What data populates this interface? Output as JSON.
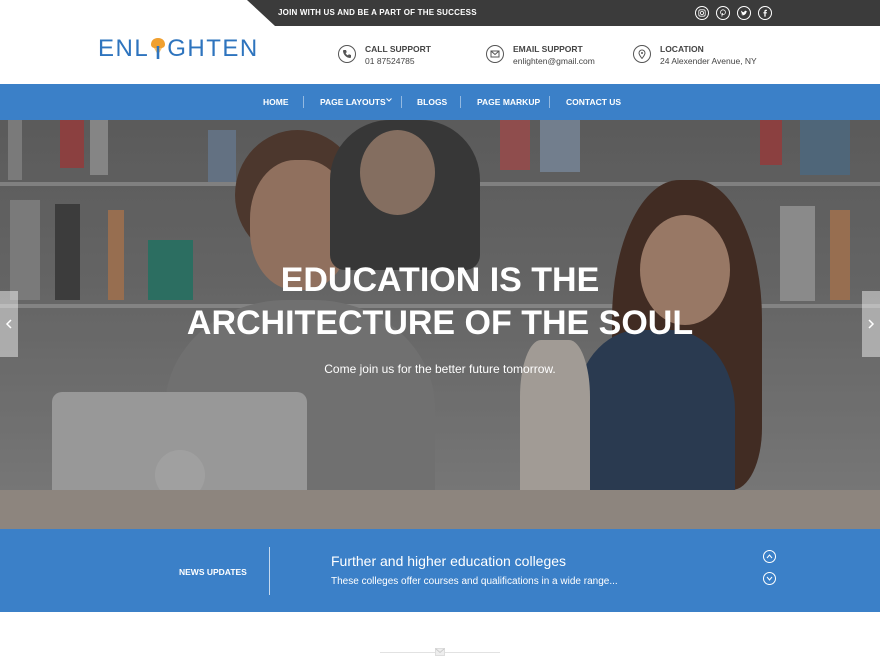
{
  "topbar": {
    "tagline": "JOIN WITH US AND BE A PART OF THE SUCCESS",
    "social": [
      "instagram-icon",
      "pinterest-icon",
      "twitter-icon",
      "facebook-icon"
    ]
  },
  "brand": {
    "left": "ENL",
    "right": "GHTEN",
    "color": "#2e74be",
    "accent": "#f0a030"
  },
  "contact": {
    "call": {
      "title": "CALL SUPPORT",
      "value": "01 87524785"
    },
    "email": {
      "title": "EMAIL SUPPORT",
      "value": "enlighten@gmail.com"
    },
    "location": {
      "title": "LOCATION",
      "value": "24 Alexender Avenue, NY"
    }
  },
  "nav": {
    "items": [
      {
        "label": "HOME"
      },
      {
        "label": "PAGE LAYOUTS"
      },
      {
        "label": "BLOGS"
      },
      {
        "label": "PAGE MARKUP"
      },
      {
        "label": "CONTACT US"
      }
    ],
    "color": "#3b80c8"
  },
  "hero": {
    "title_line1": "EDUCATION IS THE",
    "title_line2": "ARCHITECTURE OF THE SOUL",
    "subtitle": "Come join us for the better future tomorrow."
  },
  "news": {
    "label": "NEWS UPDATES",
    "title": "Further and higher education colleges",
    "description": "These colleges offer courses and qualifications in a wide range..."
  }
}
